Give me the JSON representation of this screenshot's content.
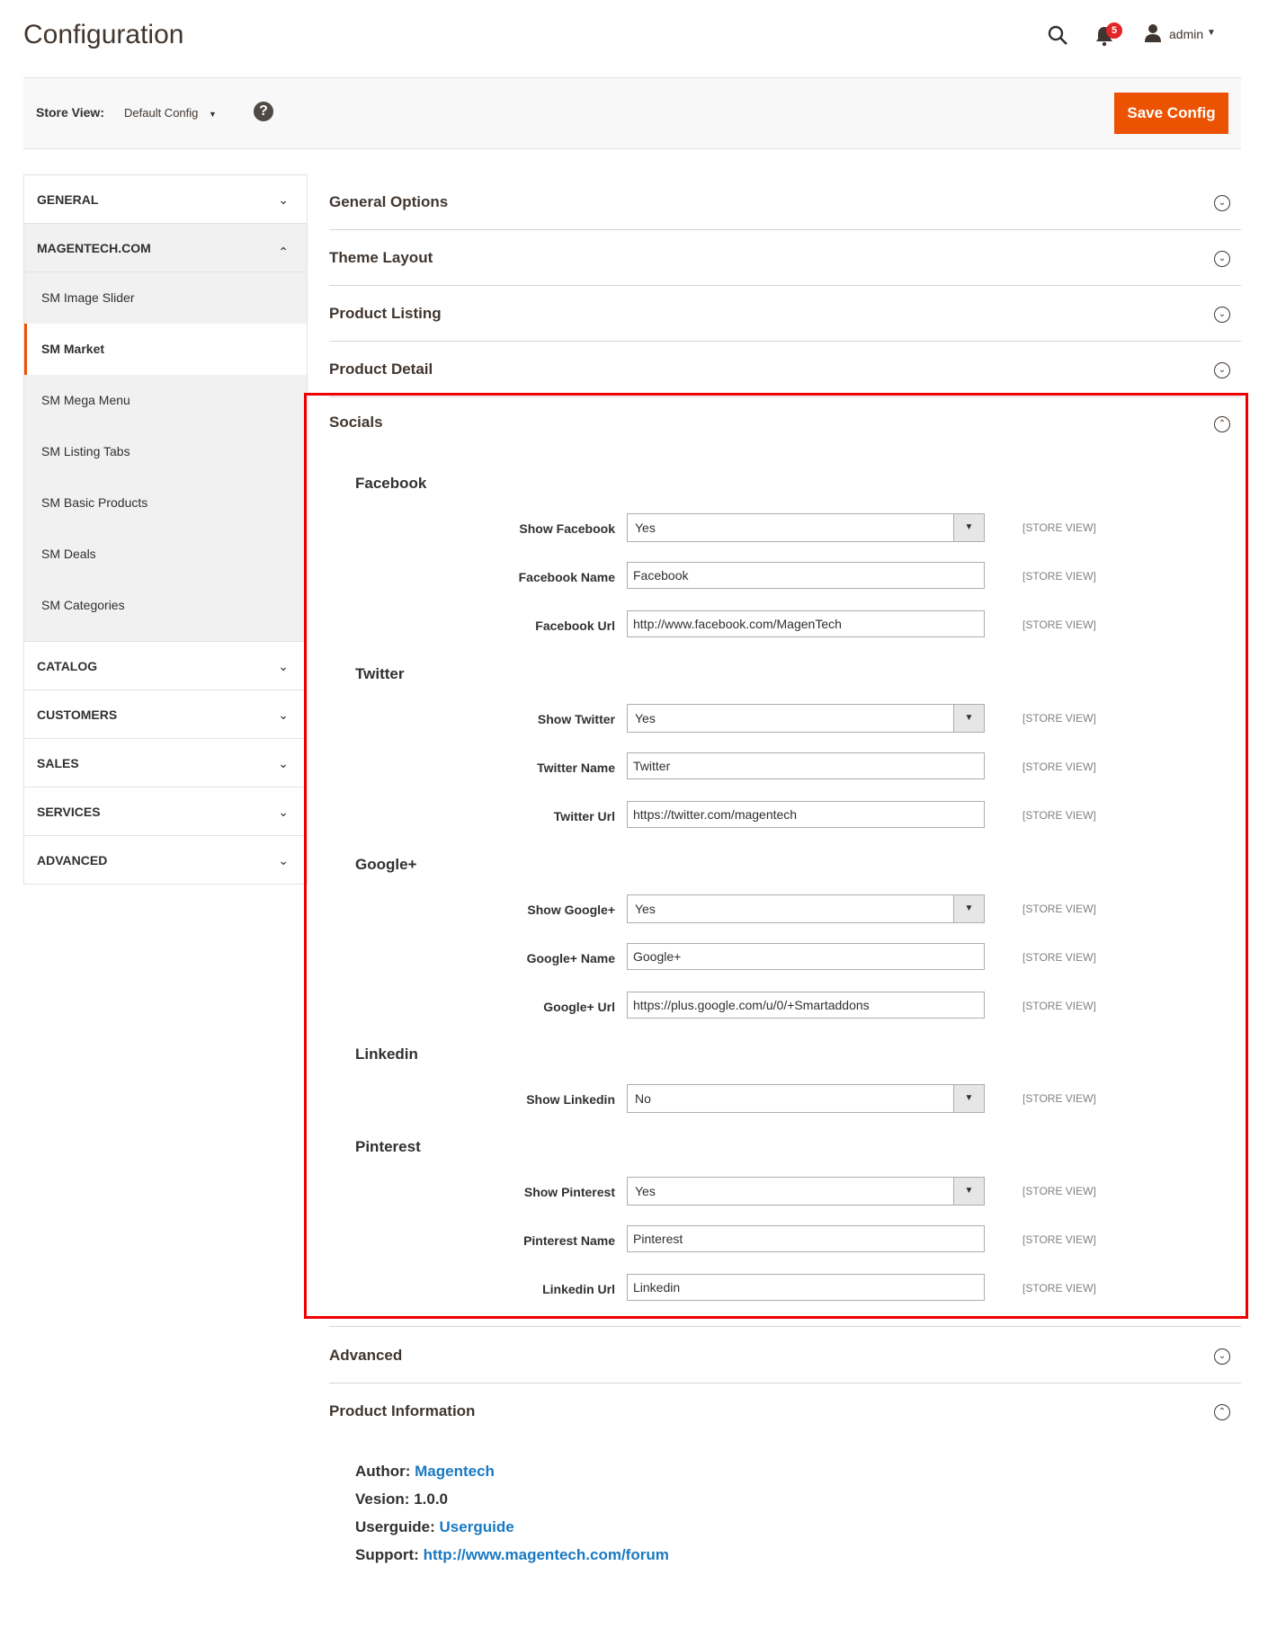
{
  "header": {
    "title": "Configuration",
    "notification_count": "5",
    "user_name": "admin"
  },
  "toolbar": {
    "store_view_label": "Store View:",
    "store_view_value": "Default Config",
    "help_glyph": "?",
    "save_label": "Save Config"
  },
  "sidebar": {
    "sections": [
      {
        "label": "GENERAL",
        "open": false
      },
      {
        "label": "MAGENTECH.COM",
        "open": true
      }
    ],
    "items": [
      "SM Image Slider",
      "SM Market",
      "SM Mega Menu",
      "SM Listing Tabs",
      "SM Basic Products",
      "SM Deals",
      "SM Categories"
    ],
    "active_item": "SM Market",
    "more_sections": [
      "CATALOG",
      "CUSTOMERS",
      "SALES",
      "SERVICES",
      "ADVANCED"
    ]
  },
  "main": {
    "collapsed_sections": [
      "General Options",
      "Theme Layout",
      "Product Listing",
      "Product Detail"
    ],
    "socials": {
      "title": "Socials",
      "scope_label": "[STORE VIEW]",
      "groups": [
        {
          "title": "Facebook",
          "fields": [
            {
              "label": "Show Facebook",
              "value": "Yes",
              "type": "select"
            },
            {
              "label": "Facebook Name",
              "value": "Facebook",
              "type": "text"
            },
            {
              "label": "Facebook Url",
              "value": "http://www.facebook.com/MagenTech",
              "type": "text"
            }
          ]
        },
        {
          "title": "Twitter",
          "fields": [
            {
              "label": "Show Twitter",
              "value": "Yes",
              "type": "select"
            },
            {
              "label": "Twitter Name",
              "value": "Twitter",
              "type": "text"
            },
            {
              "label": "Twitter Url",
              "value": "https://twitter.com/magentech",
              "type": "text"
            }
          ]
        },
        {
          "title": "Google+",
          "fields": [
            {
              "label": "Show Google+",
              "value": "Yes",
              "type": "select"
            },
            {
              "label": "Google+ Name",
              "value": "Google+",
              "type": "text"
            },
            {
              "label": "Google+ Url",
              "value": "https://plus.google.com/u/0/+Smartaddons",
              "type": "text"
            }
          ]
        },
        {
          "title": "Linkedin",
          "fields": [
            {
              "label": "Show Linkedin",
              "value": "No",
              "type": "select"
            }
          ]
        },
        {
          "title": "Pinterest",
          "fields": [
            {
              "label": "Show Pinterest",
              "value": "Yes",
              "type": "select"
            },
            {
              "label": "Pinterest Name",
              "value": "Pinterest",
              "type": "text"
            },
            {
              "label": "Linkedin Url",
              "value": "Linkedin",
              "type": "text"
            }
          ]
        }
      ]
    },
    "advanced_title": "Advanced",
    "product_info": {
      "title": "Product Information",
      "author_label": "Author:",
      "author_value": "Magentech",
      "version_label": "Vesion:",
      "version_value": "1.0.0",
      "guide_label": "Userguide:",
      "guide_value": "Userguide",
      "support_label": "Support:",
      "support_value": "http://www.magentech.com/forum"
    }
  },
  "colors": {
    "accent": "#eb5202",
    "highlight_border": "#e00000",
    "link": "#1979c3"
  }
}
